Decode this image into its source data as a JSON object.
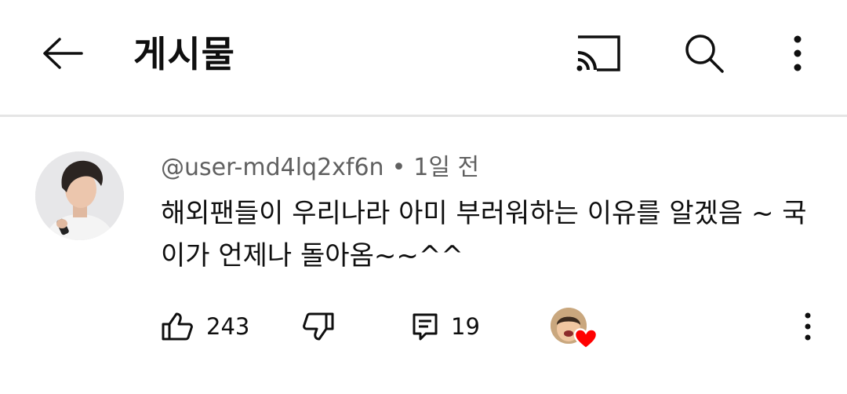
{
  "header": {
    "title": "게시물",
    "back_icon": "arrow-left-icon",
    "cast_icon": "cast-icon",
    "search_icon": "search-icon",
    "more_icon": "more-vert-icon"
  },
  "comment": {
    "author": "@user-md4lq2xf6n",
    "separator": "•",
    "time": "1일 전",
    "text": "해외팬들이 우리나라 아미 부러워하는 이유를 알겠음 ~ 국이가 언제나 돌아옴~~^^",
    "likes": "243",
    "replies": "19",
    "creator_heart": true,
    "heart_color": "#ff0000"
  }
}
